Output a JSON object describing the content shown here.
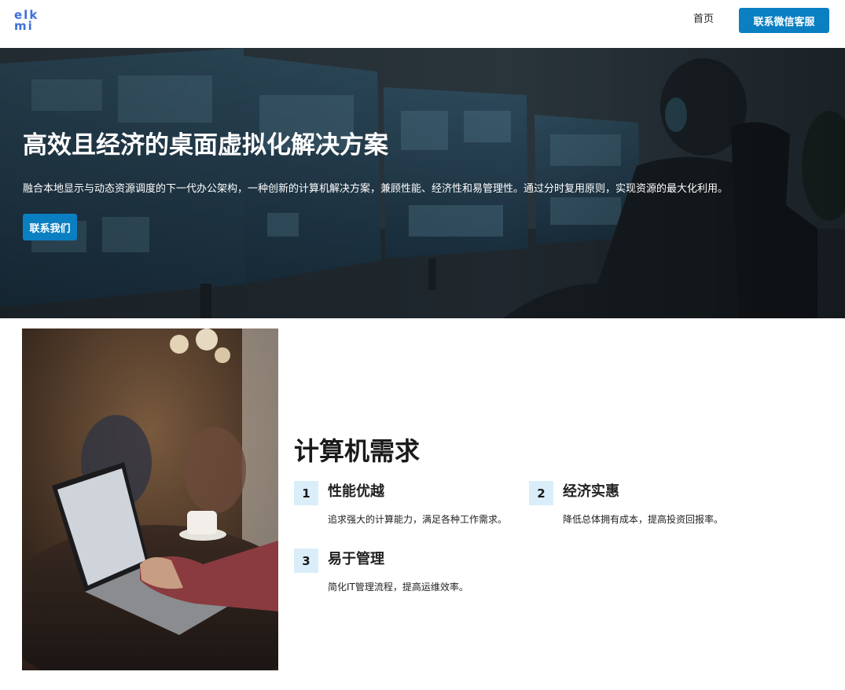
{
  "header": {
    "logo_line1": "elk",
    "logo_line2": "mi",
    "nav_home": "首页",
    "contact_button": "联系微信客服"
  },
  "hero": {
    "title": "高效且经济的桌面虚拟化解决方案",
    "description": "融合本地显示与动态资源调度的下一代办公架构，一种创新的计算机解决方案，兼顾性能、经济性和易管理性。通过分时复用原则，实现资源的最大化利用。",
    "button": "联系我们"
  },
  "section": {
    "title": "计算机需求",
    "features": [
      {
        "num": "1",
        "title": "性能优越",
        "desc": "追求强大的计算能力，满足各种工作需求。"
      },
      {
        "num": "2",
        "title": "经济实惠",
        "desc": "降低总体拥有成本，提高投资回报率。"
      },
      {
        "num": "3",
        "title": "易于管理",
        "desc": "简化IT管理流程，提高运维效率。"
      }
    ]
  },
  "colors": {
    "accent": "#0a7fc2",
    "logo": "#3f6fd8",
    "number_badge": "#d9eef9"
  }
}
